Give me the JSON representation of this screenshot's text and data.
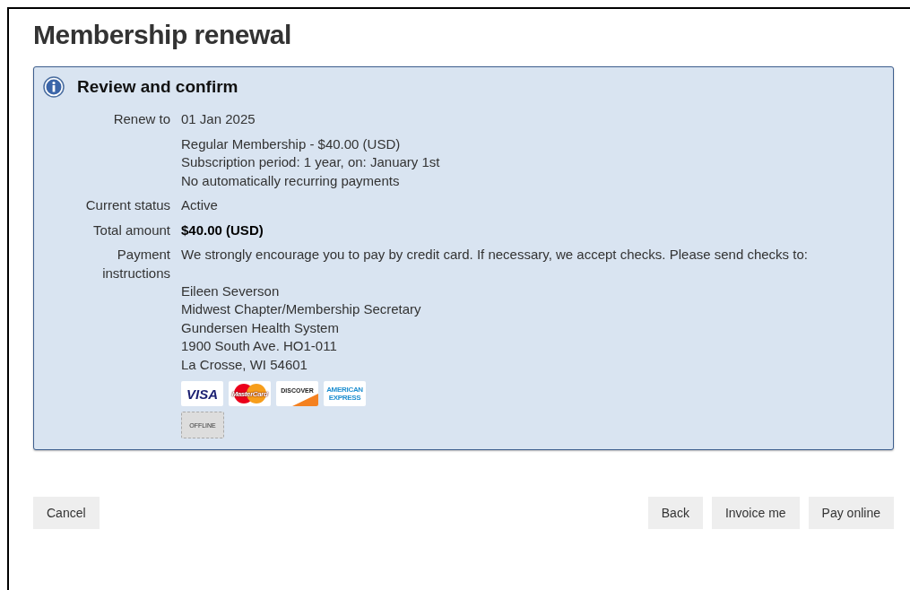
{
  "page": {
    "title": "Membership renewal"
  },
  "panel": {
    "title": "Review and confirm",
    "rows": [
      {
        "label": "Renew to",
        "lines": [
          "01 Jan 2025"
        ]
      },
      {
        "label": "",
        "lines": [
          "Regular Membership - $40.00 (USD)",
          "Subscription period: 1 year, on: January 1st",
          "No automatically recurring payments"
        ]
      },
      {
        "label": "Current status",
        "lines": [
          "Active"
        ]
      },
      {
        "label": "Total amount",
        "lines": [
          "$40.00 (USD)"
        ],
        "bold": true
      },
      {
        "label": "Payment instructions",
        "lines": [
          "We strongly encourage you to pay by credit card. If necessary, we accept checks. Please send checks to:"
        ],
        "address": [
          "Eileen Severson",
          "Midwest Chapter/Membership Secretary",
          "Gundersen Health System",
          "1900 South Ave. HO1-011",
          "La Crosse, WI 54601"
        ]
      }
    ],
    "cards": [
      {
        "kind": "visa",
        "text": "VISA"
      },
      {
        "kind": "mastercard",
        "text": "MasterCard"
      },
      {
        "kind": "discover",
        "text": "DISCOVER"
      },
      {
        "kind": "amex",
        "text": "AMERICAN EXPRESS"
      }
    ],
    "offline": "OFFLINE"
  },
  "buttons_left": [
    "Cancel"
  ],
  "buttons_right": [
    "Back",
    "Invoice me",
    "Pay online"
  ]
}
